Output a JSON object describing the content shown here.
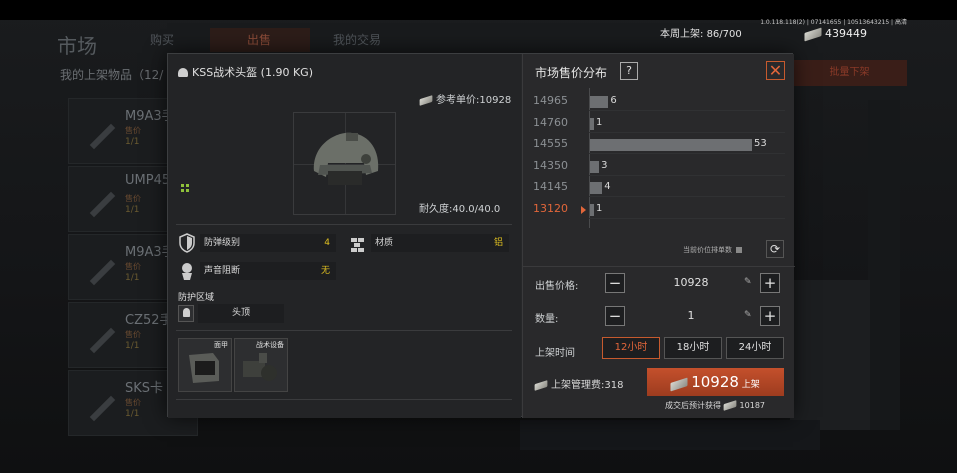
{
  "version": "1.0.118.118(2) | 07141655 | 10513643215 | 高清",
  "background": {
    "title": "市场",
    "tabs": [
      "购买",
      "出售",
      "我的交易"
    ],
    "my_list": "我的上架物品（12/",
    "items": [
      {
        "name": "M9A3手",
        "sub": "售价",
        "count": "1/1"
      },
      {
        "name": "UMP45",
        "sub": "售价",
        "count": "1/1"
      },
      {
        "name": "M9A3手",
        "sub": "售价",
        "count": "1/1"
      },
      {
        "name": "CZ52手",
        "sub": "售价",
        "count": "1/1"
      },
      {
        "name": "SKS卡",
        "sub": "售价",
        "count": "1/1"
      }
    ],
    "right_button": "批量下架"
  },
  "top": {
    "shelf_label": "本周上架:",
    "shelf_value": "86/700",
    "money": "439449"
  },
  "item": {
    "title": "KSS战术头盔 (1.90 KG)",
    "ref_price_label": "参考单价:",
    "ref_price": "10928",
    "durability_label": "耐久度:",
    "durability": "40.0/40.0",
    "stats": [
      {
        "label": "防弹级别",
        "value": "4"
      },
      {
        "label": "材质",
        "value": "铝"
      },
      {
        "label": "声音阻断",
        "value": "无"
      }
    ],
    "protection_label": "防护区域",
    "protection_zone": "头顶",
    "slots": [
      "面甲",
      "战术设备"
    ]
  },
  "market": {
    "title": "市场售价分布",
    "help": "?",
    "close": "✕",
    "auto_label": "当前价位排单数",
    "refresh": "⟳",
    "sell_price_label": "出售价格:",
    "sell_price": "10928",
    "quantity_label": "数量:",
    "quantity": "1",
    "time_label": "上架时间",
    "time_options": [
      "12小时",
      "18小时",
      "24小时"
    ],
    "time_selected": 0,
    "fee_label": "上架管理费:",
    "fee": "318",
    "list_value": "10928",
    "list_label": "上架",
    "after_sale_label": "成交后预计获得",
    "after_sale": "10187"
  },
  "chart_data": {
    "type": "bar",
    "orientation": "horizontal",
    "categories": [
      "14965",
      "14760",
      "14555",
      "14350",
      "14145",
      "13120"
    ],
    "values": [
      6,
      1,
      53,
      3,
      4,
      1
    ],
    "current_price": "13120",
    "xlim": [
      0,
      53
    ]
  }
}
